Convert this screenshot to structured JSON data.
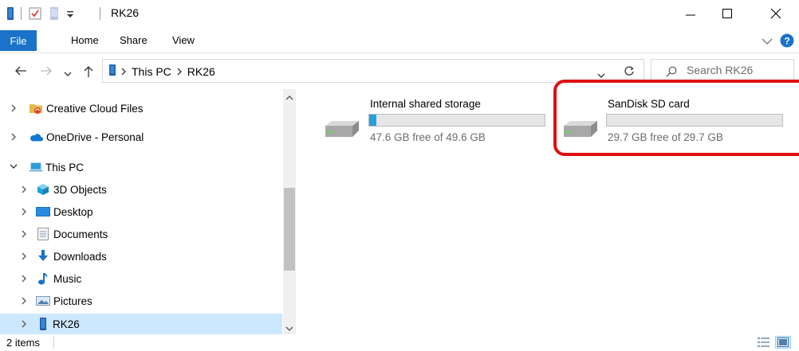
{
  "window": {
    "title": "RK26"
  },
  "ribbon": {
    "tabs": [
      {
        "label": "File"
      },
      {
        "label": "Home"
      },
      {
        "label": "Share"
      },
      {
        "label": "View"
      }
    ]
  },
  "address": {
    "crumbs": [
      "This PC",
      "RK26"
    ],
    "search_placeholder": "Search RK26"
  },
  "nav": {
    "items": [
      {
        "label": "Creative Cloud Files",
        "icon": "creative-cloud-folder-icon",
        "expanded": false,
        "selected": false
      },
      {
        "label": "OneDrive - Personal",
        "icon": "onedrive-cloud-icon",
        "expanded": false,
        "selected": false
      },
      {
        "label": "This PC",
        "icon": "this-pc-icon",
        "expanded": true,
        "selected": false
      },
      {
        "label": "3D Objects",
        "icon": "3d-objects-icon",
        "expanded": false,
        "selected": false
      },
      {
        "label": "Desktop",
        "icon": "desktop-icon",
        "expanded": false,
        "selected": false
      },
      {
        "label": "Documents",
        "icon": "documents-icon",
        "expanded": false,
        "selected": false
      },
      {
        "label": "Downloads",
        "icon": "downloads-icon",
        "expanded": false,
        "selected": false
      },
      {
        "label": "Music",
        "icon": "music-icon",
        "expanded": false,
        "selected": false
      },
      {
        "label": "Pictures",
        "icon": "pictures-icon",
        "expanded": false,
        "selected": false
      },
      {
        "label": "RK26",
        "icon": "device-icon",
        "expanded": false,
        "selected": true
      }
    ]
  },
  "content": {
    "drives": [
      {
        "name": "Internal shared storage",
        "free_text": "47.6 GB free of 49.6 GB",
        "used_fraction": 0.04
      },
      {
        "name": "SanDisk SD card",
        "free_text": "29.7 GB free of 29.7 GB",
        "used_fraction": 0.0
      }
    ]
  },
  "status": {
    "item_count": "2 items"
  },
  "colors": {
    "accent": "#1a73c9",
    "bar_fill": "#26a0da",
    "selection": "#cce8ff",
    "highlight": "#e01010"
  }
}
